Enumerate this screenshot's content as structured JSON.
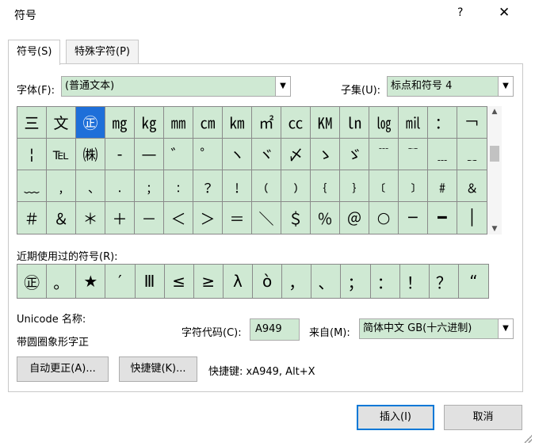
{
  "window": {
    "title": "符号",
    "help": "?",
    "close": "✕"
  },
  "tabs": [
    {
      "label": "符号(S)"
    },
    {
      "label": "特殊字符(P)"
    }
  ],
  "font": {
    "label": "字体(F):",
    "value": "(普通文本)"
  },
  "subset": {
    "label": "子集(U):",
    "value": "标点和符号 4"
  },
  "symbols": [
    "㆔",
    "文",
    "㊣",
    "㎎",
    "㎏",
    "㎜",
    "㎝",
    "㎞",
    "㎡",
    "㏄",
    "㏎",
    "㏑",
    "㏒",
    "㏕",
    "：",
    "￢",
    "¦",
    "℡",
    "㈱",
    "‐",
    "—",
    "゛",
    "゜",
    "ヽ",
    "ヾ",
    "〆",
    "ゝ",
    "ゞ",
    "﹉",
    "﹊",
    "﹍",
    "﹎",
    "﹏",
    "﹐",
    "﹑",
    "﹒",
    "﹔",
    "﹕",
    "﹖",
    "﹗",
    "﹙",
    "﹚",
    "﹛",
    "﹜",
    "﹝",
    "﹞",
    "﹟",
    "﹠",
    "＃",
    "＆",
    "＊",
    "＋",
    "－",
    "＜",
    "＞",
    "＝",
    "＼",
    "＄",
    "％",
    "＠",
    "○",
    "─",
    "━",
    "│"
  ],
  "selected_symbol": "㊣",
  "recent": {
    "label": "近期使用过的符号(R):",
    "symbols": [
      "㊣",
      "。",
      "★",
      "′",
      "Ⅲ",
      "≤",
      "≥",
      "λ",
      "ò",
      "，",
      "、",
      "；",
      "：",
      "！",
      "？",
      "“"
    ]
  },
  "unicode": {
    "label": "Unicode 名称:",
    "name": "带圆圈象形字正"
  },
  "char_code": {
    "label": "字符代码(C):",
    "value": "A949"
  },
  "from": {
    "label": "来自(M):",
    "value": "简体中文 GB(十六进制)"
  },
  "buttons": {
    "autocorrect": "自动更正(A)...",
    "shortcut_key": "快捷键(K)...",
    "insert": "插入(I)",
    "cancel": "取消"
  },
  "shortcut_text": "快捷键: xA949, Alt+X"
}
